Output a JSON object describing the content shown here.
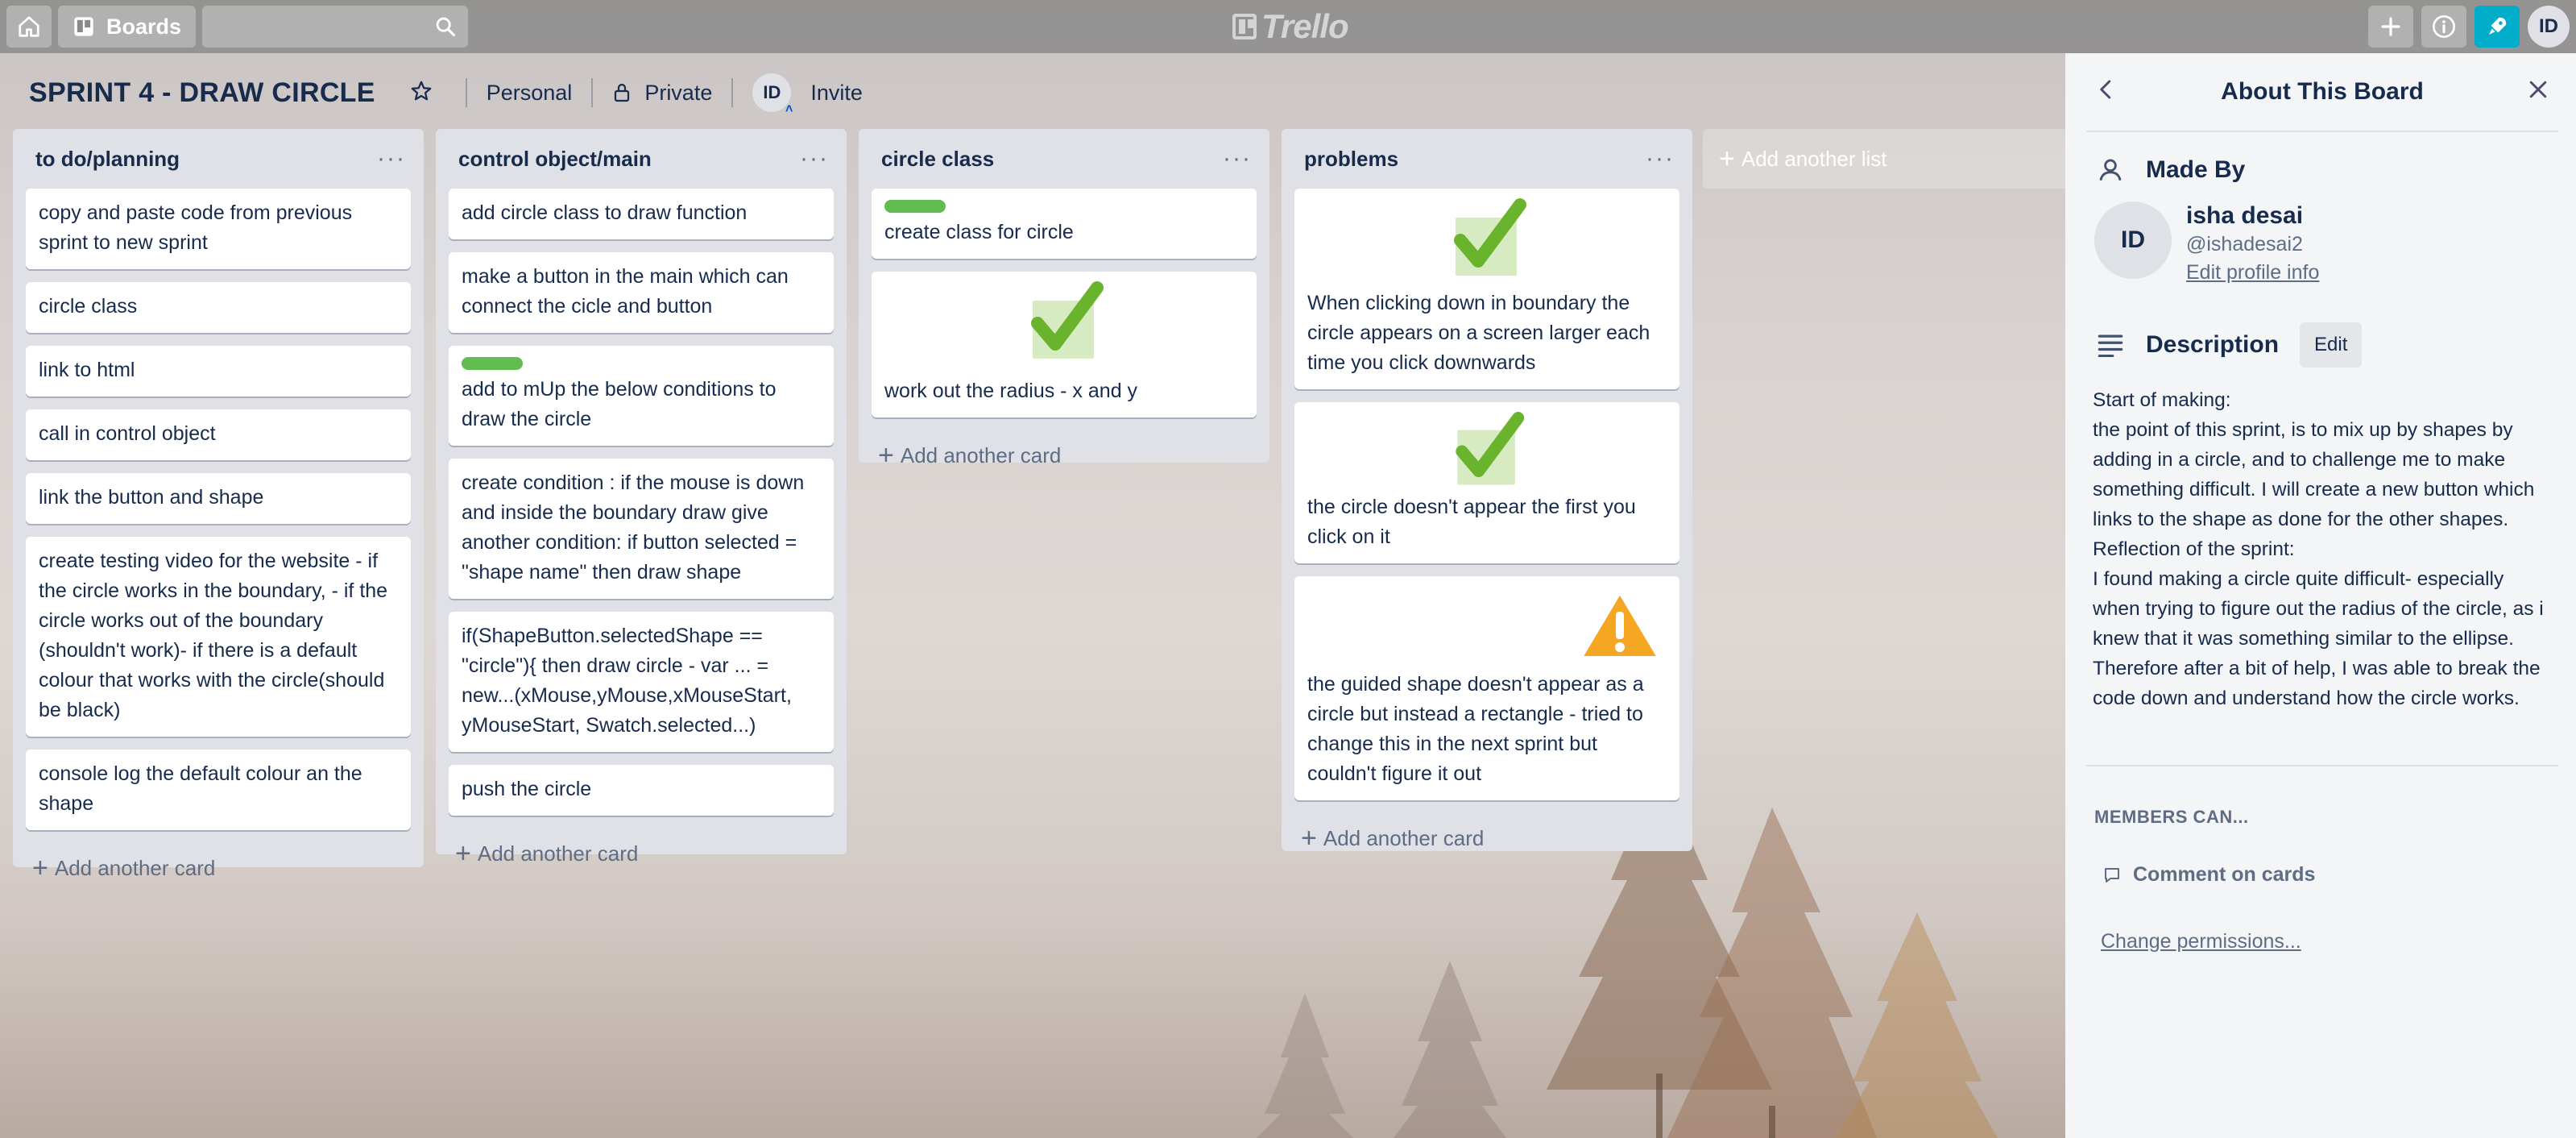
{
  "nav": {
    "home_icon": "home-icon",
    "boards_label": "Boards",
    "search_placeholder": "",
    "logo_text": "Trello",
    "avatar_initials": "ID"
  },
  "board": {
    "title": "SPRINT 4 - DRAW CIRCLE",
    "team": "Personal",
    "visibility": "Private",
    "member_initials": "ID",
    "invite_label": "Invite"
  },
  "lists": [
    {
      "title": "to do/planning",
      "cards": [
        {
          "text": "copy and paste code from previous sprint to new sprint"
        },
        {
          "text": "circle class"
        },
        {
          "text": "link to html"
        },
        {
          "text": "call in control object"
        },
        {
          "text": "link the button and shape"
        },
        {
          "text": "create testing video for the website - if the circle works in the boundary, - if the circle works out of the boundary (shouldn't work)- if there is a default colour that works with the circle(should be black)"
        },
        {
          "text": "console log the default colour an the shape"
        }
      ],
      "add_card_label": "Add another card"
    },
    {
      "title": "control object/main",
      "cards": [
        {
          "text": "add circle class to draw function"
        },
        {
          "text": "make a button in the main which can connect the cicle and button"
        },
        {
          "text": "add to mUp the below conditions to draw the circle",
          "label": "green"
        },
        {
          "text": "create condition : if the mouse is down and inside the boundary draw give another condition: if button selected = \"shape name\" then draw shape"
        },
        {
          "text": "if(ShapeButton.selectedShape == \"circle\"){ then draw circle - var ... = new...(xMouse,yMouse,xMouseStart, yMouseStart, Swatch.selected...)"
        },
        {
          "text": "push the circle"
        }
      ],
      "add_card_label": "Add another card"
    },
    {
      "title": "circle class",
      "cards": [
        {
          "text": "create class for circle",
          "label": "green"
        },
        {
          "text": "work out the radius - x and y",
          "cover": "checkmark-icon"
        }
      ],
      "add_card_label": "Add another card"
    },
    {
      "title": "problems",
      "cards": [
        {
          "text": "When clicking down in boundary the circle appears on a screen larger each time you click downwards",
          "cover": "checkmark-icon"
        },
        {
          "text": "the circle doesn't appear the first you click on it",
          "cover": "checkmark-icon"
        },
        {
          "text": "the guided shape doesn't appear as a circle but instead a rectangle - tried to change this in the next sprint but couldn't figure it out",
          "cover": "warning-icon"
        }
      ],
      "add_card_label": "Add another card"
    }
  ],
  "add_list_label": "Add another list",
  "panel": {
    "title": "About This Board",
    "made_by_heading": "Made By",
    "user_initials": "ID",
    "user_name": "isha desai",
    "user_handle": "@ishadesai2",
    "edit_profile": "Edit profile info",
    "description_heading": "Description",
    "edit_label": "Edit",
    "description_lines": [
      "Start of making:",
      "the point of this sprint, is to mix up by shapes by adding in a circle, and to challenge me to make something difficult. I will create a new button which links to the shape as done for the other shapes.",
      "Reflection of the sprint:",
      "I found making a circle quite difficult- especially when trying to figure out the radius of the circle, as i knew that it was something similar to the ellipse. Therefore after a bit of help, I was able to break the code down and understand how the circle works."
    ],
    "members_can": "MEMBERS CAN...",
    "comment_permission": "Comment on cards",
    "change_permissions": "Change permissions..."
  },
  "colors": {
    "label_green": "#61bd4f",
    "accent_cyan": "#00aecc",
    "list_bg": "#dfe1e6",
    "text_primary": "#172b4d"
  }
}
